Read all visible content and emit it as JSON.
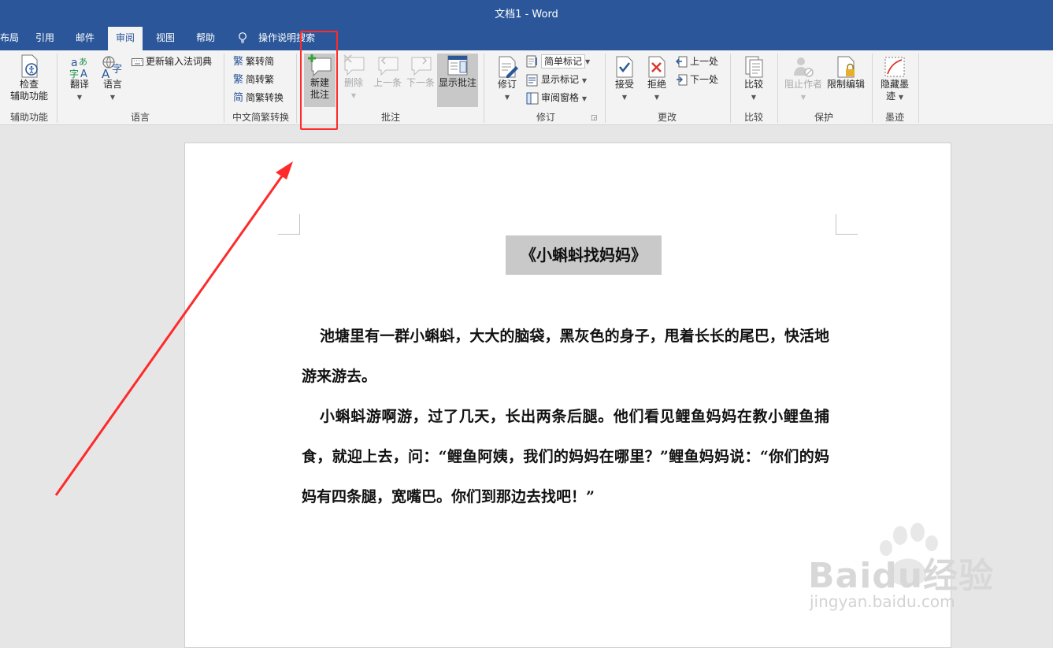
{
  "window": {
    "title": "文档1  -  Word"
  },
  "tabs": [
    {
      "label": "布局"
    },
    {
      "label": "引用"
    },
    {
      "label": "邮件"
    },
    {
      "label": "审阅"
    },
    {
      "label": "视图"
    },
    {
      "label": "帮助"
    },
    {
      "label": "操作说明搜索"
    }
  ],
  "ribbon": {
    "accessibility": {
      "check_label_1": "检查",
      "check_label_2": "辅助功能",
      "group_label": "辅助功能"
    },
    "language": {
      "translate_label": "翻译",
      "language_label": "语言",
      "update_ime_label": "更新输入法词典",
      "group_label": "语言"
    },
    "chinese_conversion": {
      "to_simplified": "繁转简",
      "to_traditional": "简转繁",
      "convert": "简繁转换",
      "group_label": "中文简繁转换"
    },
    "comments": {
      "new_comment_1": "新建",
      "new_comment_2": "批注",
      "delete": "删除",
      "previous": "上一条",
      "next": "下一条",
      "show_comments": "显示批注",
      "group_label": "批注"
    },
    "tracking": {
      "track_changes": "修订",
      "markup_select": "简单标记",
      "show_markup": "显示标记",
      "reviewing_pane": "审阅窗格",
      "group_label": "修订"
    },
    "changes": {
      "accept": "接受",
      "reject": "拒绝",
      "previous": "上一处",
      "next": "下一处",
      "group_label": "更改"
    },
    "compare": {
      "compare": "比较",
      "group_label": "比较"
    },
    "protect": {
      "block_authors": "阻止作者",
      "restrict_editing": "限制编辑",
      "group_label": "保护"
    },
    "ink": {
      "hide_ink_1": "隐藏墨",
      "hide_ink_2": "迹",
      "group_label": "墨迹"
    }
  },
  "document": {
    "title": "《小蝌蚪找妈妈》",
    "paragraphs": [
      "池塘里有一群小蝌蚪，大大的脑袋，黑灰色的身子，甩着长长的尾巴，快活地游来游去。",
      "小蝌蚪游啊游，过了几天，长出两条后腿。他们看见鲤鱼妈妈在教小鲤鱼捕食，就迎上去，问：“鲤鱼阿姨，我们的妈妈在哪里？”鲤鱼妈妈说：“你们的妈妈有四条腿，宽嘴巴。你们到那边去找吧！”"
    ]
  },
  "watermark": {
    "brand": "Baidu经验",
    "url": "jingyan.baidu.com"
  },
  "colors": {
    "titlebar": "#2b579a",
    "highlight": "#ff2a2a",
    "ribbon": "#f3f3f3"
  }
}
